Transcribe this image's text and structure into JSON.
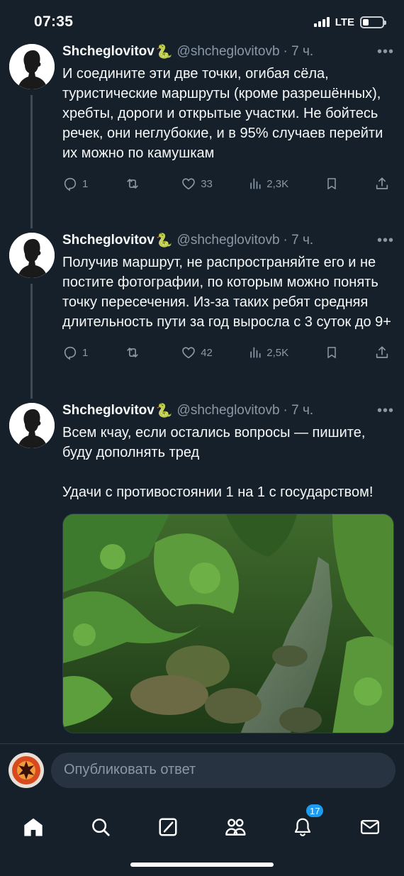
{
  "status_bar": {
    "time": "07:35",
    "network": "LTE",
    "battery_level": 0.3
  },
  "tweets": [
    {
      "author": "Shcheglovitov",
      "emoji": "🐍",
      "handle": "@shcheglovitovb",
      "time": "· 7 ч.",
      "text": "И соедините эти две точки, огибая сёла, туристические маршруты (кроме разрешённых), хребты, дороги и открытые участки. Не бойтесь речек, они неглубокие, и в 95% случаев перейти их можно по камушкам",
      "replies": "1",
      "retweets": "",
      "likes": "33",
      "views": "2,3K"
    },
    {
      "author": "Shcheglovitov",
      "emoji": "🐍",
      "handle": "@shcheglovitovb",
      "time": "· 7 ч.",
      "text": "Получив маршрут, не распространяйте его и не постите фотографии, по которым можно понять точку пересечения. Из-за таких ребят средняя длительность пути за год выросла с 3 суток до 9+",
      "replies": "1",
      "retweets": "",
      "likes": "42",
      "views": "2,5K"
    },
    {
      "author": "Shcheglovitov",
      "emoji": "🐍",
      "handle": "@shcheglovitovb",
      "time": "· 7 ч.",
      "text": "Всем кчау, если остались вопросы — пишите, буду дополнять тред\n\nУдачи с противостоянии 1 на 1 с государством!"
    }
  ],
  "reply": {
    "placeholder": "Опубликовать ответ"
  },
  "nav": {
    "notifications_badge": "17"
  },
  "icons": [
    "home-icon",
    "search-icon",
    "grok-icon",
    "communities-icon",
    "notifications-icon",
    "messages-icon"
  ],
  "colors": {
    "background": "#15202b",
    "accent": "#1d9bf0",
    "muted": "#8b98a5"
  }
}
